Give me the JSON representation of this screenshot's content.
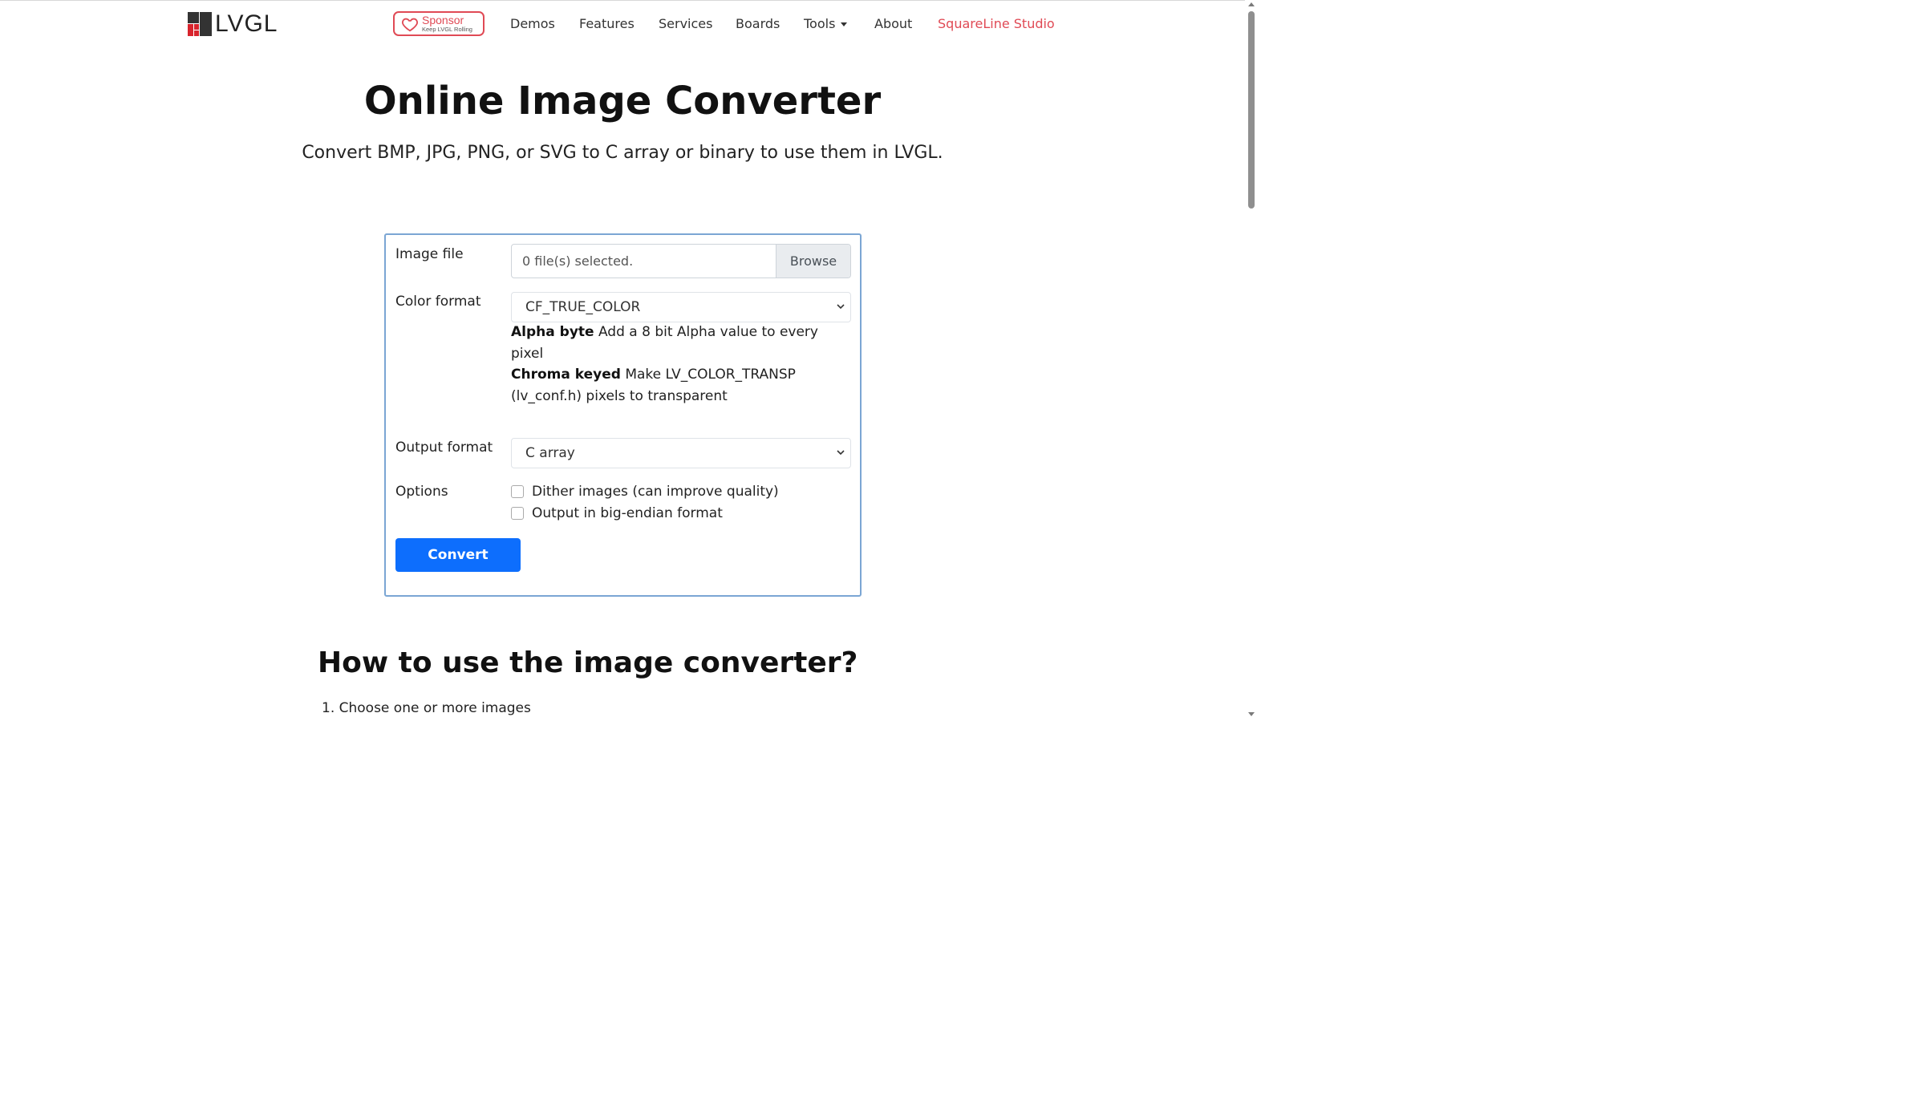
{
  "brand": {
    "name": "LVGL"
  },
  "sponsor": {
    "title": "Sponsor",
    "tagline": "Keep LVGL Rolling"
  },
  "nav": {
    "demos": "Demos",
    "features": "Features",
    "services": "Services",
    "boards": "Boards",
    "tools": "Tools",
    "about": "About",
    "squareline": "SquareLine Studio"
  },
  "page": {
    "title": "Online Image Converter",
    "subtitle": "Convert BMP, JPG, PNG, or SVG to C array or binary to use them in LVGL."
  },
  "form": {
    "image_file_label": "Image file",
    "file_status": "0 file(s) selected.",
    "browse_label": "Browse",
    "color_format_label": "Color format",
    "color_format_value": "CF_TRUE_COLOR",
    "help_alpha_title": "Alpha byte",
    "help_alpha_text": "Add a 8 bit Alpha value to every pixel",
    "help_chroma_title": "Chroma keyed",
    "help_chroma_text": "Make LV_COLOR_TRANSP (lv_conf.h) pixels to transparent",
    "output_format_label": "Output format",
    "output_format_value": "C array",
    "options_label": "Options",
    "option_dither": "Dither images (can improve quality)",
    "option_big_endian": "Output in big-endian format",
    "convert_label": "Convert"
  },
  "howto": {
    "title": "How to use the image converter?",
    "step1": "Choose one or more images"
  },
  "colors": {
    "accent": "#e04a55",
    "primary_button": "#0d6efd",
    "card_border": "#7ba6d4"
  }
}
